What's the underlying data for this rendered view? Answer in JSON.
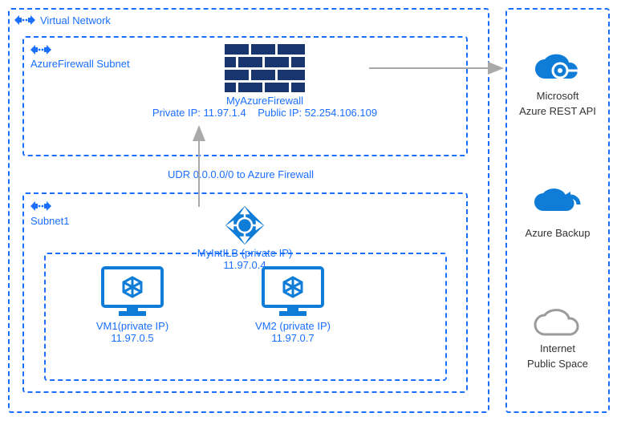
{
  "vnet": {
    "label": "Virtual Network"
  },
  "fwSubnet": {
    "label": "AzureFirewall Subnet"
  },
  "firewall": {
    "name": "MyAzureFirewall",
    "privateIpLabel": "Private IP: 11.97.1.4",
    "publicIpLabel": "Public IP: 52.254.106.109"
  },
  "udr": {
    "text": "UDR 0.0.0.0/0 to Azure Firewall"
  },
  "subnet1": {
    "label": "Subnet1"
  },
  "ilb": {
    "name": "MyIntILB (private IP)",
    "ip": "11.97.0.4"
  },
  "vm1": {
    "name": "VM1(private IP)",
    "ip": "11.97.0.5"
  },
  "vm2": {
    "name": "VM2 (private IP)",
    "ip": "11.97.0.7"
  },
  "services": {
    "restApi": {
      "line1": "Microsoft",
      "line2": "Azure REST API"
    },
    "backup": {
      "label": "Azure Backup"
    },
    "internet": {
      "line1": "Internet",
      "line2": "Public Space"
    }
  },
  "chart_data": {
    "type": "diagram",
    "nodes": [
      {
        "id": "vnet",
        "label": "Virtual Network",
        "type": "container"
      },
      {
        "id": "fwSubnet",
        "label": "AzureFirewall Subnet",
        "type": "container",
        "parent": "vnet"
      },
      {
        "id": "firewall",
        "label": "MyAzureFirewall",
        "privateIp": "11.97.1.4",
        "publicIp": "52.254.106.109",
        "parent": "fwSubnet"
      },
      {
        "id": "subnet1",
        "label": "Subnet1",
        "type": "container",
        "parent": "vnet"
      },
      {
        "id": "ilb",
        "label": "MyIntILB (private IP)",
        "ip": "11.97.0.4",
        "parent": "subnet1"
      },
      {
        "id": "vm1",
        "label": "VM1(private IP)",
        "ip": "11.97.0.5",
        "parent": "subnet1"
      },
      {
        "id": "vm2",
        "label": "VM2 (private IP)",
        "ip": "11.97.0.7",
        "parent": "subnet1"
      },
      {
        "id": "restApi",
        "label": "Microsoft Azure REST API",
        "type": "external"
      },
      {
        "id": "backup",
        "label": "Azure Backup",
        "type": "external"
      },
      {
        "id": "internet",
        "label": "Internet Public Space",
        "type": "external"
      }
    ],
    "edges": [
      {
        "from": "ilb",
        "to": "firewall",
        "label": "UDR 0.0.0.0/0 to Azure Firewall"
      },
      {
        "from": "firewall",
        "to": "restApi"
      }
    ]
  }
}
